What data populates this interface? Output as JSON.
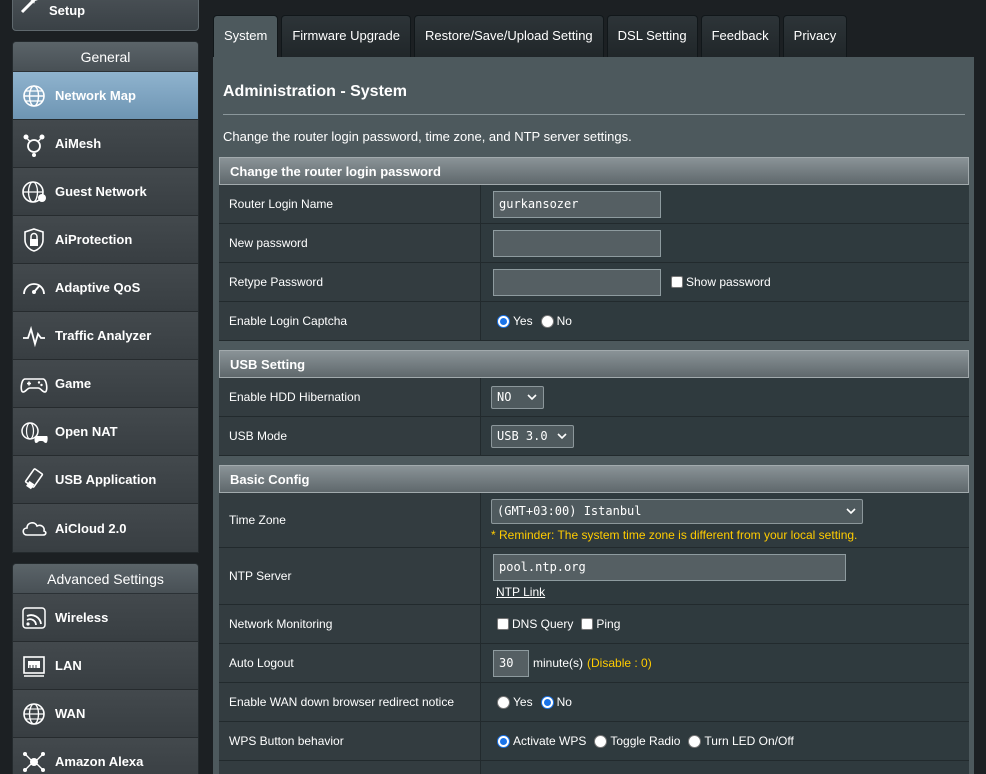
{
  "sidebar": {
    "top_item": {
      "label": "Setup",
      "icon": "wand-icon"
    },
    "general": {
      "heading": "General",
      "items": [
        {
          "label": "Network Map",
          "icon": "globe-icon",
          "active": true
        },
        {
          "label": "AiMesh",
          "icon": "mesh-icon"
        },
        {
          "label": "Guest Network",
          "icon": "guest-globe-icon"
        },
        {
          "label": "AiProtection",
          "icon": "lock-shield-icon"
        },
        {
          "label": "Adaptive QoS",
          "icon": "speedometer-icon"
        },
        {
          "label": "Traffic Analyzer",
          "icon": "pulse-icon"
        },
        {
          "label": "Game",
          "icon": "gamepad-icon"
        },
        {
          "label": "Open NAT",
          "icon": "open-nat-icon"
        },
        {
          "label": "USB Application",
          "icon": "usb-icon"
        },
        {
          "label": "AiCloud 2.0",
          "icon": "cloud-icon"
        }
      ]
    },
    "advanced": {
      "heading": "Advanced Settings",
      "items": [
        {
          "label": "Wireless",
          "icon": "wifi-icon"
        },
        {
          "label": "LAN",
          "icon": "lan-icon"
        },
        {
          "label": "WAN",
          "icon": "wan-globe-icon"
        },
        {
          "label": "Amazon Alexa",
          "icon": "alexa-icon"
        }
      ]
    }
  },
  "tabs": [
    {
      "label": "System",
      "active": true
    },
    {
      "label": "Firmware Upgrade"
    },
    {
      "label": "Restore/Save/Upload Setting"
    },
    {
      "label": "DSL Setting"
    },
    {
      "label": "Feedback"
    },
    {
      "label": "Privacy"
    }
  ],
  "page": {
    "title": "Administration - System",
    "description": "Change the router login password, time zone, and NTP server settings."
  },
  "login_section": {
    "heading": "Change the router login password",
    "login_name_label": "Router Login Name",
    "login_name_value": "gurkansozer",
    "new_password_label": "New password",
    "new_password_value": "",
    "retype_label": "Retype Password",
    "retype_value": "",
    "show_password_label": "Show password",
    "captcha_label": "Enable Login Captcha",
    "captcha_yes": "Yes",
    "captcha_no": "No",
    "captcha_selected": "Yes"
  },
  "usb_section": {
    "heading": "USB Setting",
    "hibernation_label": "Enable HDD Hibernation",
    "hibernation_value": "NO",
    "usb_mode_label": "USB Mode",
    "usb_mode_value": "USB 3.0"
  },
  "basic_section": {
    "heading": "Basic Config",
    "timezone_label": "Time Zone",
    "timezone_value": "(GMT+03:00) Istanbul",
    "timezone_reminder": "* Reminder: The system time zone is different from your local setting.",
    "ntp_label": "NTP Server",
    "ntp_value": "pool.ntp.org",
    "ntp_link": "NTP Link",
    "monitoring_label": "Network Monitoring",
    "monitoring_dns": "DNS Query",
    "monitoring_ping": "Ping",
    "autologout_label": "Auto Logout",
    "autologout_value": "30",
    "autologout_unit": "minute(s)",
    "autologout_hint": "(Disable : 0)",
    "wan_notice_label": "Enable WAN down browser redirect notice",
    "wan_notice_yes": "Yes",
    "wan_notice_no": "No",
    "wps_label": "WPS Button behavior",
    "wps_activate": "Activate WPS",
    "wps_toggle": "Toggle Radio",
    "wps_led": "Turn LED On/Off"
  },
  "colors": {
    "accent_active_tab": "#4d595d",
    "active_menu": "#7fa4c1",
    "reminder": "#ffcc00",
    "radio_selected": "#1a73e8"
  }
}
